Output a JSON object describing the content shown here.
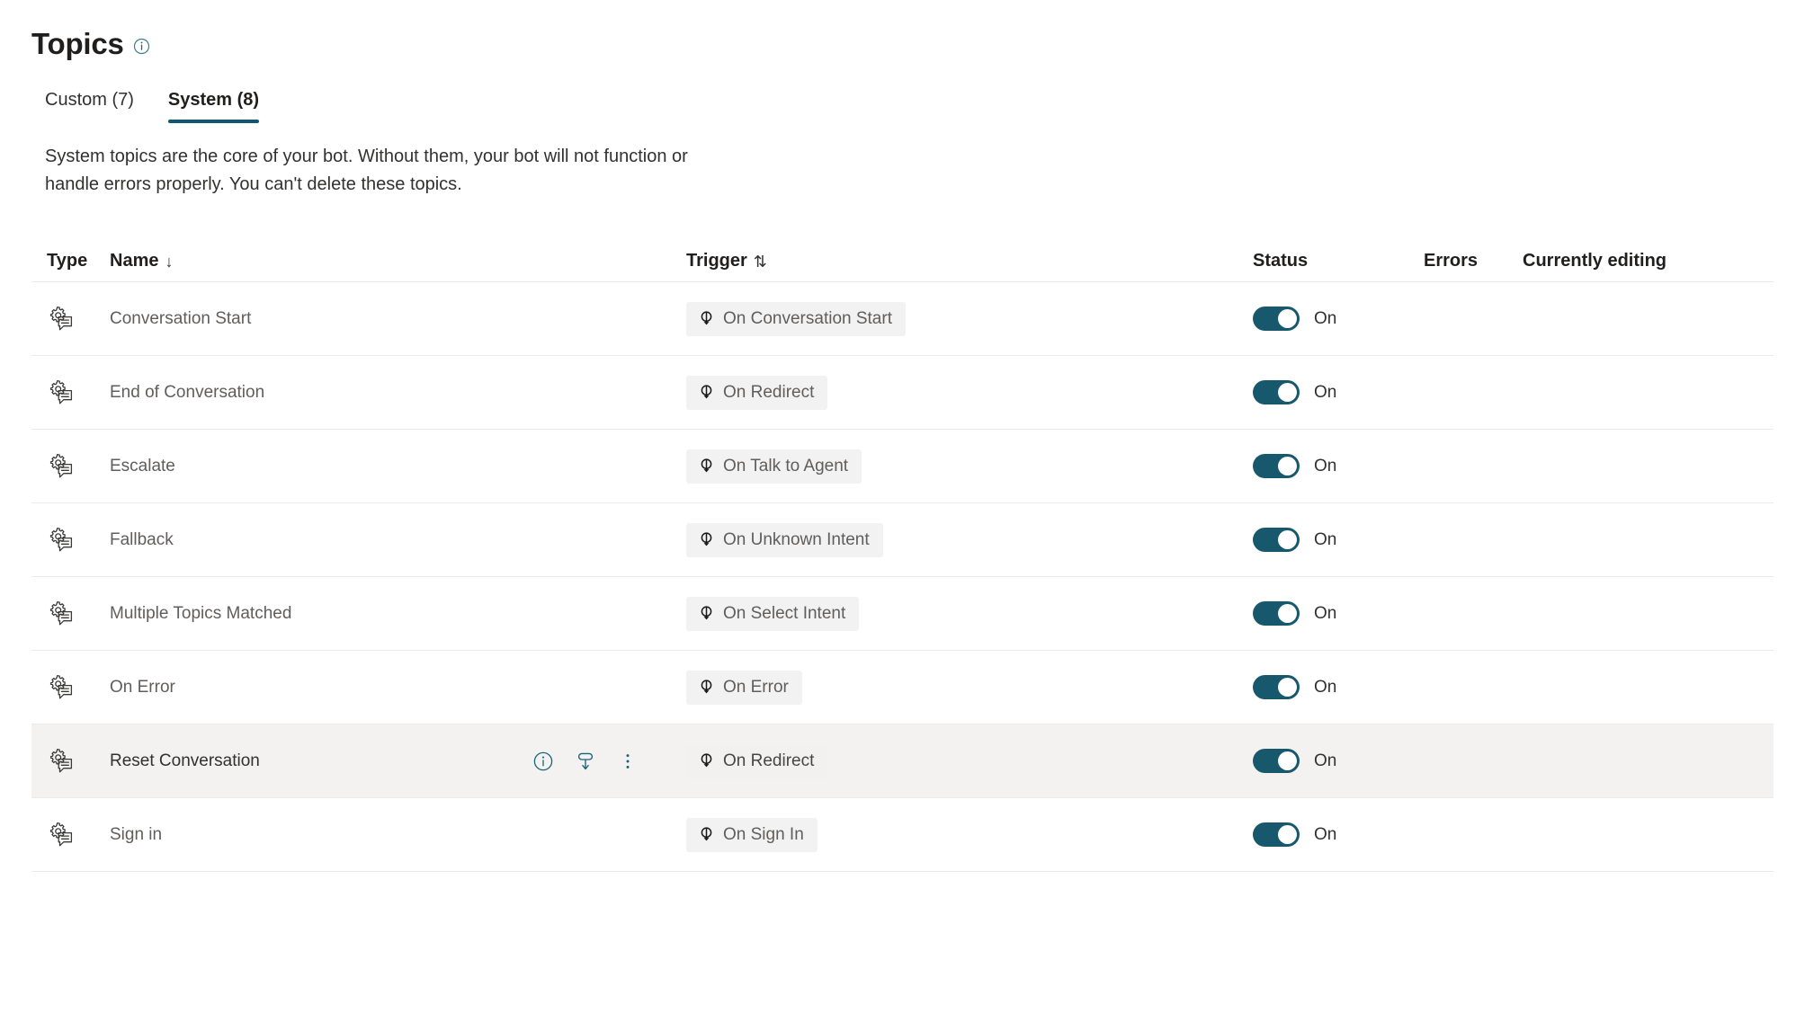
{
  "header": {
    "title": "Topics",
    "info_icon": "info-circle-icon"
  },
  "tabs": [
    {
      "label": "Custom (7)",
      "selected": false,
      "name": "tab-custom"
    },
    {
      "label": "System (8)",
      "selected": true,
      "name": "tab-system"
    }
  ],
  "accent_color": "#10586E",
  "toggle_on_color": "#17586C",
  "hover_row_color": "#F3F2F1",
  "pill_color": "#F2F2F2",
  "description": "System topics are the core of your bot. Without them, your bot will not function or handle errors properly. You can't delete these topics.",
  "table": {
    "columns": [
      {
        "label": "Type",
        "sort": "",
        "name": "column-header-type"
      },
      {
        "label": "Name",
        "sort": "↓",
        "name": "column-header-name"
      },
      {
        "label": "Trigger",
        "sort": "⇅",
        "name": "column-header-trigger"
      },
      {
        "label": "Status",
        "sort": "",
        "name": "column-header-status"
      },
      {
        "label": "Errors",
        "sort": "",
        "name": "column-header-errors"
      },
      {
        "label": "Currently editing",
        "sort": "",
        "name": "column-header-currently-editing"
      }
    ],
    "rows": [
      {
        "type_icon": "system-topic-icon",
        "name": "Conversation Start",
        "trigger": "On Conversation Start",
        "status": "On",
        "status_on": true,
        "errors": "",
        "currently_editing": "",
        "hovered": false
      },
      {
        "type_icon": "system-topic-icon",
        "name": "End of Conversation",
        "trigger": "On Redirect",
        "status": "On",
        "status_on": true,
        "errors": "",
        "currently_editing": "",
        "hovered": false
      },
      {
        "type_icon": "system-topic-icon",
        "name": "Escalate",
        "trigger": "On Talk to Agent",
        "status": "On",
        "status_on": true,
        "errors": "",
        "currently_editing": "",
        "hovered": false
      },
      {
        "type_icon": "system-topic-icon",
        "name": "Fallback",
        "trigger": "On Unknown Intent",
        "status": "On",
        "status_on": true,
        "errors": "",
        "currently_editing": "",
        "hovered": false
      },
      {
        "type_icon": "system-topic-icon",
        "name": "Multiple Topics Matched",
        "trigger": "On Select Intent",
        "status": "On",
        "status_on": true,
        "errors": "",
        "currently_editing": "",
        "hovered": false
      },
      {
        "type_icon": "system-topic-icon",
        "name": "On Error",
        "trigger": "On Error",
        "status": "On",
        "status_on": true,
        "errors": "",
        "currently_editing": "",
        "hovered": false
      },
      {
        "type_icon": "system-topic-icon",
        "name": "Reset Conversation",
        "trigger": "On Redirect",
        "status": "On",
        "status_on": true,
        "errors": "",
        "currently_editing": "",
        "hovered": true
      },
      {
        "type_icon": "system-topic-icon",
        "name": "Sign in",
        "trigger": "On Sign In",
        "status": "On",
        "status_on": true,
        "errors": "",
        "currently_editing": "",
        "hovered": false
      }
    ],
    "row_actions": [
      {
        "name": "row-info-icon",
        "icon": "info-circle-icon"
      },
      {
        "name": "row-callout-icon",
        "icon": "callout-down-arrow-icon"
      },
      {
        "name": "row-more-menu-icon",
        "icon": "more-vertical-icon"
      }
    ]
  }
}
